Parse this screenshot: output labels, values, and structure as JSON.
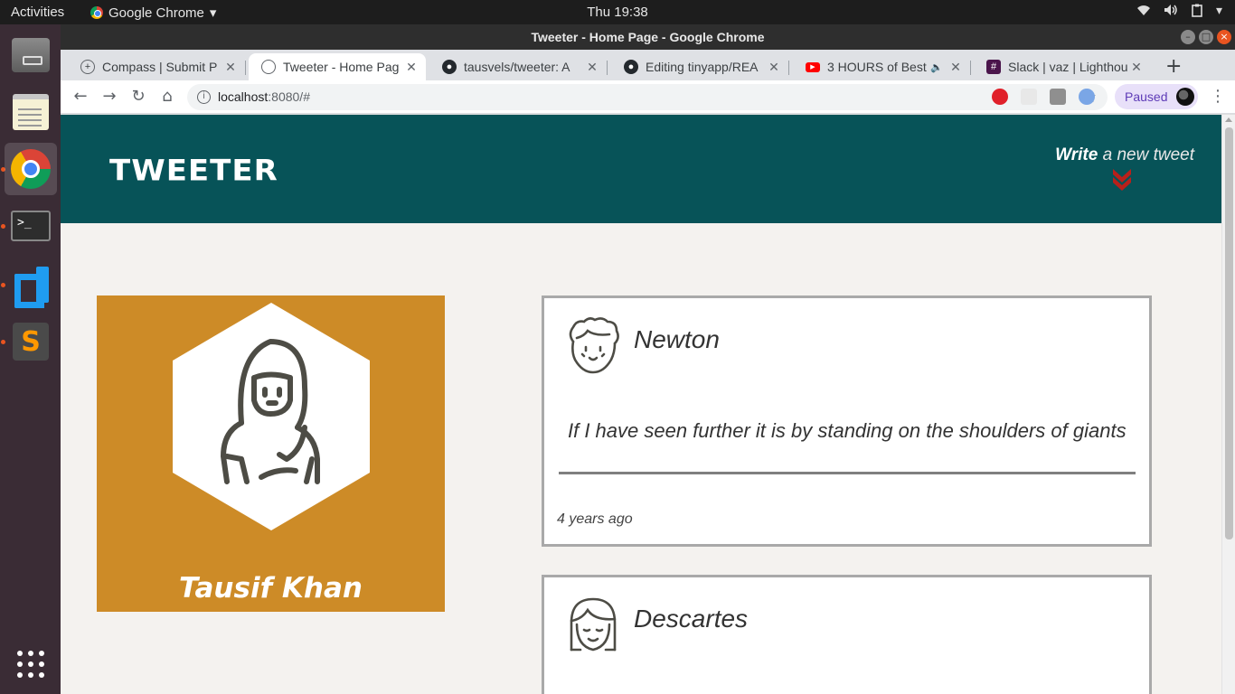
{
  "os": {
    "activities": "Activities",
    "app_name": "Google Chrome",
    "clock": "Thu 19:38"
  },
  "window": {
    "title": "Tweeter - Home Page - Google Chrome"
  },
  "tabs": [
    {
      "label": "Compass | Submit P",
      "icon": "compass-icon"
    },
    {
      "label": "Tweeter - Home Pag",
      "icon": "globe-icon",
      "active": true
    },
    {
      "label": "tausvels/tweeter: A",
      "icon": "github-icon"
    },
    {
      "label": "Editing tinyapp/REA",
      "icon": "github-icon"
    },
    {
      "label": "3 HOURS of Best",
      "icon": "youtube-icon"
    },
    {
      "label": "Slack | vaz | Lighthou",
      "icon": "slack-icon"
    }
  ],
  "toolbar": {
    "url_host": "localhost",
    "url_rest": ":8080/#",
    "profile_status": "Paused"
  },
  "page": {
    "brand": "Tweeter",
    "compose_bold": "Write",
    "compose_rest": " a new tweet",
    "accent_color": "#075358",
    "profile": {
      "name": "Tausif Khan",
      "color": "#cd8b27"
    },
    "tweets": [
      {
        "author": "Newton",
        "content": "If I have seen further it is by standing on the shoulders of giants",
        "time": "4 years ago"
      },
      {
        "author": "Descartes",
        "content": "",
        "time": ""
      }
    ]
  }
}
